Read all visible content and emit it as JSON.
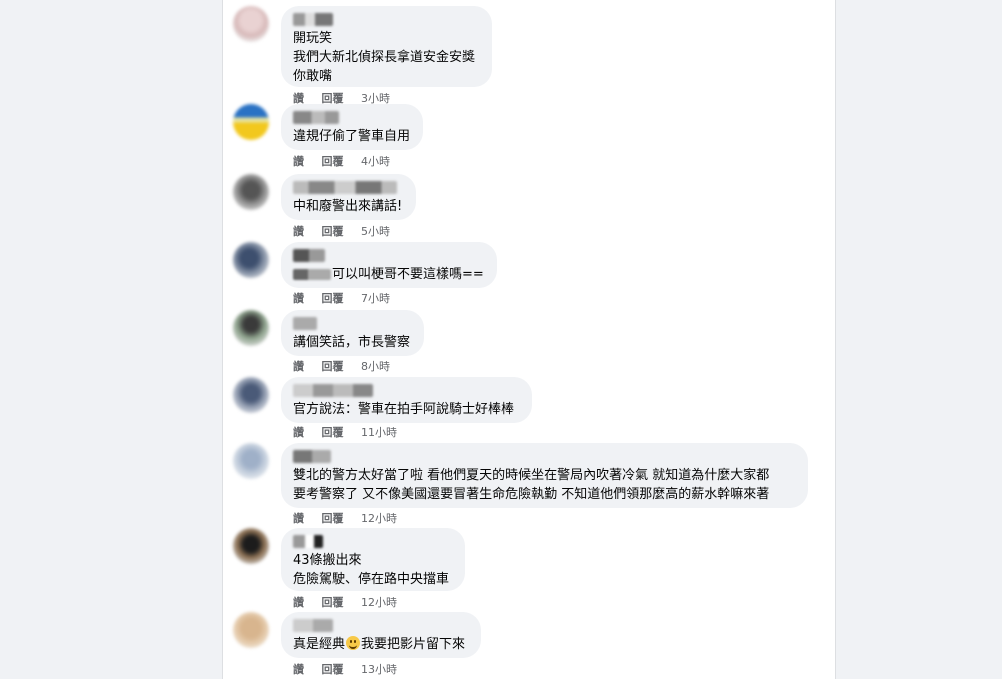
{
  "actions": {
    "like": "讚",
    "reply": "回覆"
  },
  "comments": [
    {
      "lines": [
        "開玩笑",
        "我們大新北偵探長拿道安金安獎",
        "你敢嘴"
      ],
      "time": "3小時"
    },
    {
      "lines": [
        "違規仔偷了警車自用"
      ],
      "time": "4小時"
    },
    {
      "lines": [
        "中和廢警出來講話!"
      ],
      "time": "5小時"
    },
    {
      "lines": [
        "可以叫梗哥不要這樣嗎=="
      ],
      "time": "7小時"
    },
    {
      "lines": [
        "講個笑話，市長警察"
      ],
      "time": "8小時"
    },
    {
      "lines": [
        "官方說法：警車在拍手阿說騎士好棒棒"
      ],
      "time": "11小時"
    },
    {
      "lines": [
        "雙北的警方太好當了啦 看他們夏天的時候坐在警局內吹著冷氣 就知道為什麼大家都",
        "要考警察了 又不像美國還要冒著生命危險執勤 不知道他們領那麼高的薪水幹嘛來著"
      ],
      "time": "12小時"
    },
    {
      "lines": [
        "43條搬出來",
        "危險駕駛、停在路中央擋車"
      ],
      "time": "12小時"
    },
    {
      "lines": [
        "真是經典",
        "我要把影片留下來"
      ],
      "time": "13小時"
    }
  ]
}
